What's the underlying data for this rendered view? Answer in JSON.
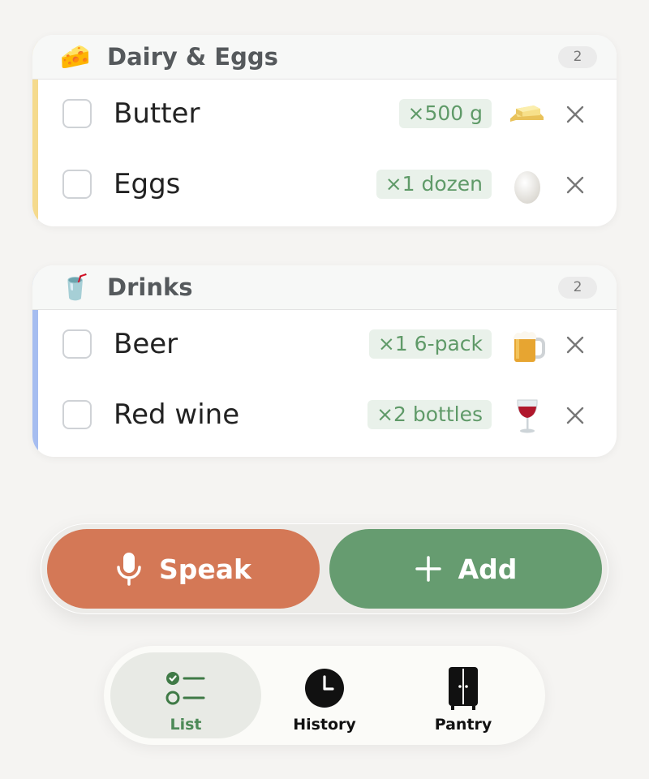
{
  "categories": [
    {
      "title": "Dairy & Eggs",
      "icon": "cheese-icon",
      "icon_glyph": "🧀",
      "accent": "#f5da8d",
      "count": "2",
      "items": [
        {
          "name": "Butter",
          "qty": "×500 g",
          "icon": "butter-icon",
          "glyph": "🧈"
        },
        {
          "name": "Eggs",
          "qty": "×1 dozen",
          "icon": "egg-icon",
          "glyph": "🥚"
        }
      ]
    },
    {
      "title": "Drinks",
      "icon": "cup-with-straw-icon",
      "icon_glyph": "🥤",
      "accent": "#a6bdf0",
      "count": "2",
      "items": [
        {
          "name": "Beer",
          "qty": "×1 6-pack",
          "icon": "beer-mug-icon",
          "glyph": "🍺"
        },
        {
          "name": "Red wine",
          "qty": "×2 bottles",
          "icon": "wine-glass-icon",
          "glyph": "🍷"
        }
      ]
    }
  ],
  "actions": {
    "speak_label": "Speak",
    "add_label": "Add",
    "speak_color": "#d47856",
    "add_color": "#669c70"
  },
  "tabs": [
    {
      "label": "List",
      "icon": "checklist-icon",
      "active": true
    },
    {
      "label": "History",
      "icon": "clock-icon",
      "active": false
    },
    {
      "label": "Pantry",
      "icon": "cupboard-icon",
      "active": false
    }
  ]
}
